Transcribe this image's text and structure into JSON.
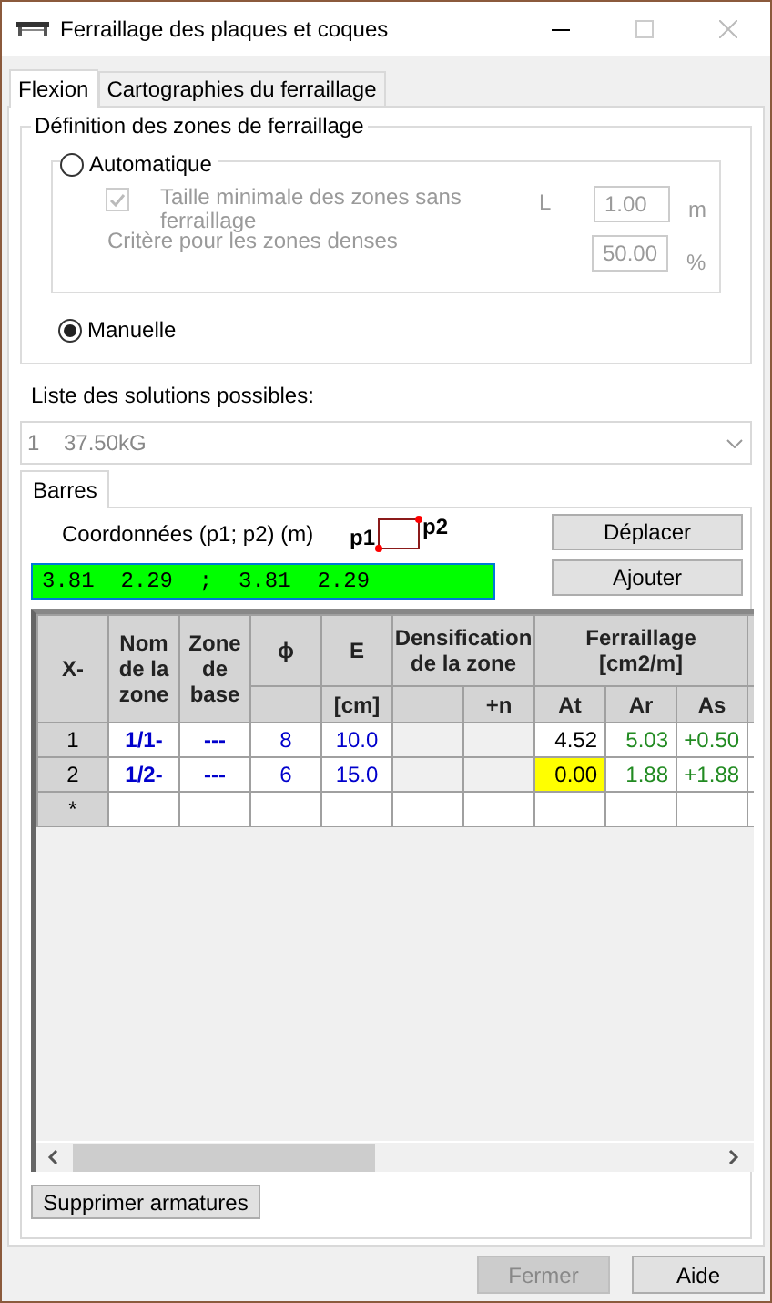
{
  "window": {
    "title": "Ferraillage des plaques et coques"
  },
  "tabs": [
    {
      "label": "Flexion",
      "selected": true
    },
    {
      "label": "Cartographies du ferraillage",
      "selected": false
    }
  ],
  "zones_group": {
    "title": "Définition des zones de ferraillage",
    "radios": [
      {
        "label": "Automatique",
        "selected": false
      },
      {
        "label": "Manuelle",
        "selected": true
      }
    ],
    "auto": {
      "disabled": true,
      "min_size": {
        "label": "Taille minimale des zones sans ferraillage",
        "checked": true,
        "symbol": "L",
        "value": "1.00",
        "unit": "m"
      },
      "dense": {
        "label": "Critère pour les zones denses",
        "value": "50.00",
        "unit": "%"
      }
    }
  },
  "solutions": {
    "label": "Liste des solutions possibles:",
    "index": "1",
    "value": "37.50kG",
    "disabled": true
  },
  "subtabs": [
    {
      "label": "Barres",
      "selected": true
    }
  ],
  "coords": {
    "label": "Coordonnées (p1; p2) (m)",
    "p1": "p1",
    "p2": "p2",
    "value": "3.81  2.29  ;  3.81  2.29"
  },
  "side_buttons": [
    "Déplacer",
    "Ajouter"
  ],
  "table": {
    "corner": "X-",
    "columns": [
      {
        "title": "Nom de la zone",
        "split": false
      },
      {
        "title": "Zone de base",
        "split": false
      },
      {
        "title": "ϕ",
        "split": true
      },
      {
        "title": "E",
        "split": true,
        "sub": "[cm]"
      }
    ],
    "groups": [
      {
        "title": "Densification de la zone",
        "leading_blank": true,
        "subs": [
          "+n"
        ]
      },
      {
        "title": "Ferraillage [cm2/m]",
        "leading_blank": false,
        "subs": [
          "At",
          "Ar",
          "As"
        ]
      }
    ],
    "rows": [
      {
        "label": "1",
        "name": "1/1-",
        "base": "---",
        "phi": "8",
        "e": "10.0",
        "at": {
          "value": "4.52",
          "highlighted": false
        },
        "ar": "5.03",
        "as": "+0.50"
      },
      {
        "label": "2",
        "name": "1/2-",
        "base": "---",
        "phi": "6",
        "e": "15.0",
        "at": {
          "value": "0.00",
          "highlighted": true
        },
        "ar": "1.88",
        "as": "+1.88"
      }
    ],
    "new_row": "*"
  },
  "delete_button": "Supprimer armatures",
  "footer": [
    {
      "label": "Fermer",
      "disabled": true
    },
    {
      "label": "Aide",
      "disabled": false
    }
  ]
}
